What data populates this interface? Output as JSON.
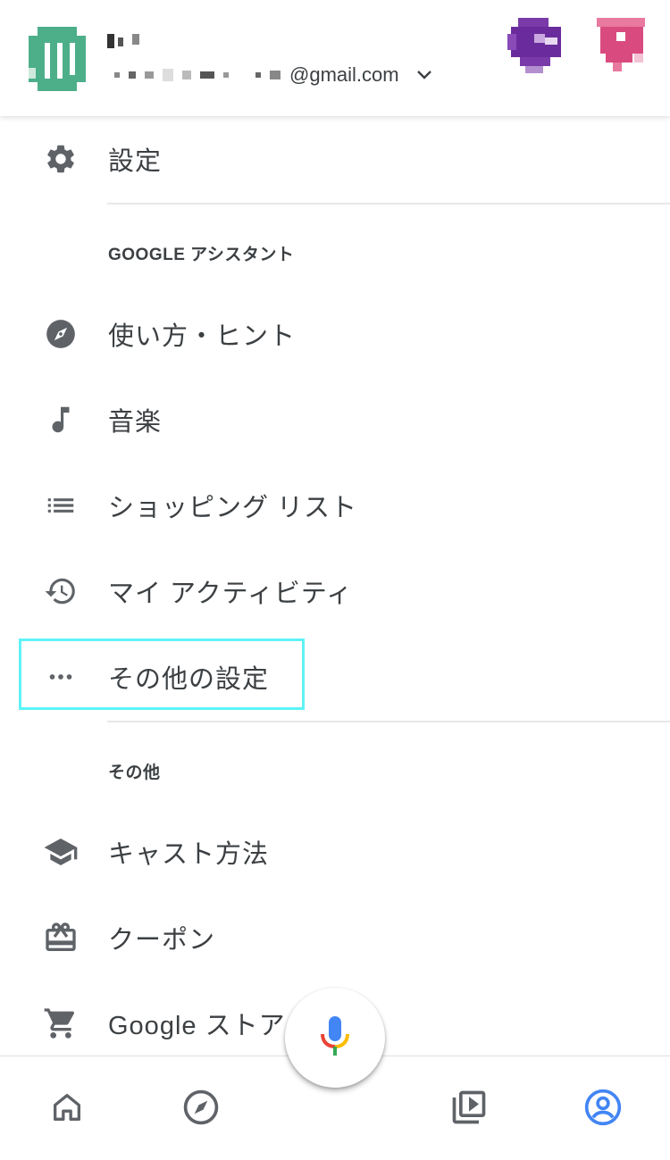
{
  "header": {
    "email_suffix": "@gmail.com",
    "avatar_icon": "account-avatar",
    "dropdown_icon": "chevron-down-icon"
  },
  "menu": {
    "settings_label": "設定",
    "assistant_section": "GOOGLE アシスタント",
    "items_assistant": [
      {
        "label": "使い方・ヒント",
        "icon": "compass-icon"
      },
      {
        "label": "音楽",
        "icon": "music-note-icon"
      },
      {
        "label": "ショッピング リスト",
        "icon": "list-icon"
      },
      {
        "label": "マイ アクティビティ",
        "icon": "history-icon"
      },
      {
        "label": "その他の設定",
        "icon": "more-horiz-icon"
      }
    ],
    "other_section": "その他",
    "items_other": [
      {
        "label": "キャスト方法",
        "icon": "school-cap-icon"
      },
      {
        "label": "クーポン",
        "icon": "coupon-icon"
      },
      {
        "label": "Google ストア",
        "icon": "cart-icon"
      }
    ]
  },
  "bottom_nav": {
    "items": [
      "home-icon",
      "discover-compass-icon",
      "mic-icon",
      "media-library-icon",
      "account-circle-icon"
    ],
    "active": "account-circle-icon"
  },
  "colors": {
    "accent_blue": "#4285f4",
    "highlight_cyan": "#5ef3f7",
    "avatar_green": "#4caf8a",
    "avatar_purple": "#6a2c9c",
    "avatar_pink": "#d94b7e",
    "icon_gray": "#5f6368"
  }
}
